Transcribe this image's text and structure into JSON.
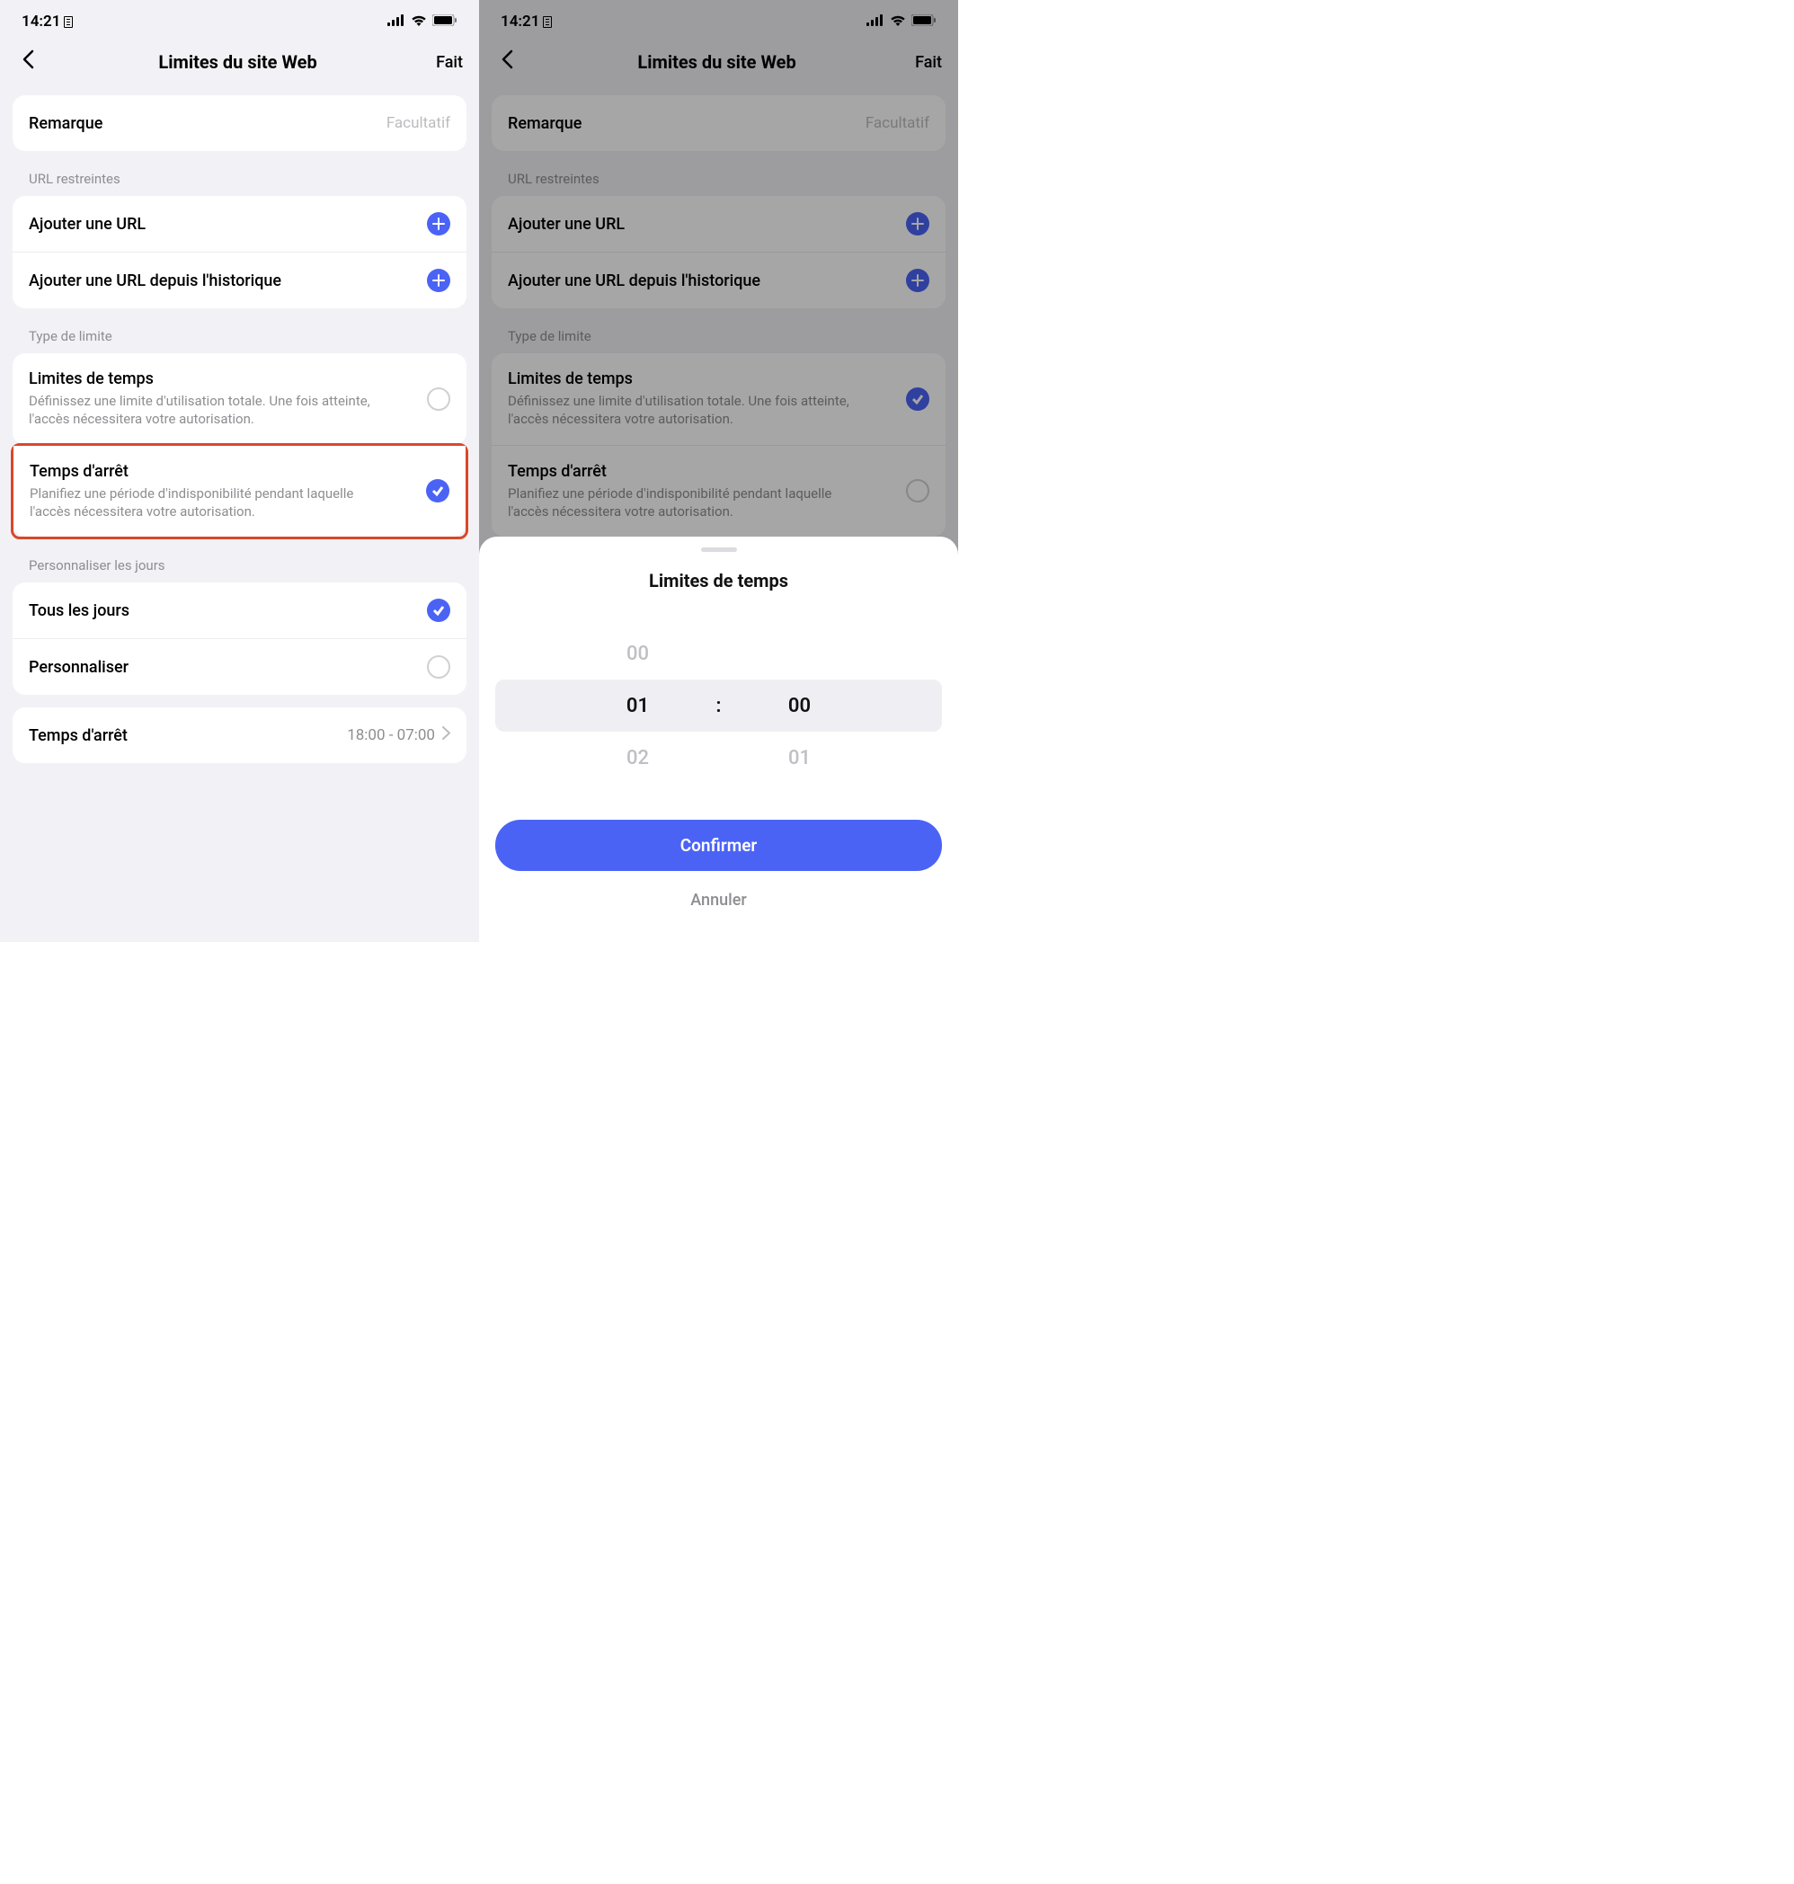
{
  "status": {
    "time": "14:21"
  },
  "nav": {
    "title": "Limites du site Web",
    "done": "Fait"
  },
  "remark": {
    "label": "Remarque",
    "placeholder": "Facultatif"
  },
  "url_section": {
    "header": "URL restreintes",
    "add_url": "Ajouter une URL",
    "add_history": "Ajouter une URL depuis l'historique"
  },
  "limit_type": {
    "header": "Type de limite",
    "time_limits": {
      "title": "Limites de temps",
      "sub": "Définissez une limite d'utilisation totale. Une fois atteinte, l'accès nécessitera votre autorisation."
    },
    "downtime": {
      "title": "Temps d'arrêt",
      "sub": "Planifiez une période d'indisponibilité pendant laquelle l'accès nécessitera votre autorisation."
    }
  },
  "days": {
    "header": "Personnaliser les jours",
    "all": "Tous les jours",
    "custom": "Personnaliser",
    "downtime_label": "Temps d'arrêt",
    "downtime_value": "18:00 - 07:00"
  },
  "sheet": {
    "title": "Limites de temps",
    "hour_prev": "00",
    "hour_sel": "01",
    "hour_next": "02",
    "min_prev": "",
    "min_sel": "00",
    "min_next": "01",
    "sep": ":",
    "confirm": "Confirmer",
    "cancel": "Annuler"
  }
}
